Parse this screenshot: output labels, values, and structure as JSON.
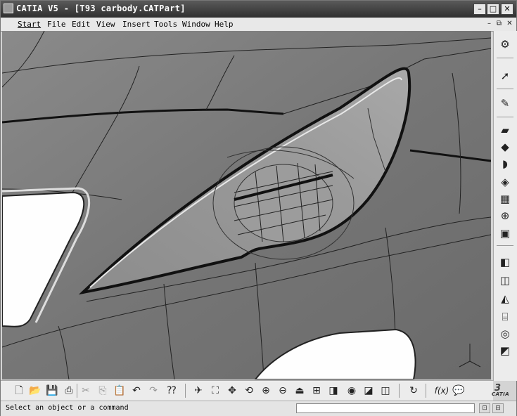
{
  "window": {
    "title": "CATIA V5 - [T93 carbody.CATPart]",
    "minimize_glyph": "–",
    "maximize_glyph": "□",
    "close_glyph": "✕"
  },
  "menu": {
    "items": [
      {
        "label": "Start",
        "active": true
      },
      {
        "label": "File"
      },
      {
        "label": "Edit"
      },
      {
        "label": "View"
      },
      {
        "label": "Insert"
      },
      {
        "label": "Tools"
      },
      {
        "label": "Window"
      },
      {
        "label": "Help"
      }
    ],
    "mdi_minimize": "–",
    "mdi_restore": "⧉",
    "mdi_close": "✕"
  },
  "right_toolbar": {
    "icons": [
      {
        "name": "sketcher-gear-icon",
        "glyph": "⚙"
      },
      {
        "name": "select-arrow-icon",
        "glyph": "➚"
      },
      {
        "name": "sketch-icon",
        "glyph": "✎"
      },
      {
        "name": "pad-icon",
        "glyph": "▰"
      },
      {
        "name": "pocket-icon",
        "glyph": "◆"
      },
      {
        "name": "shaft-icon",
        "glyph": "◗"
      },
      {
        "name": "hole-icon",
        "glyph": "◈"
      },
      {
        "name": "rib-icon",
        "glyph": "▦"
      },
      {
        "name": "axis-system-icon",
        "glyph": "⊕"
      },
      {
        "name": "box-icon",
        "glyph": "▣"
      },
      {
        "name": "plane-icon",
        "glyph": "◧"
      },
      {
        "name": "offset-icon",
        "glyph": "◫"
      },
      {
        "name": "shell-icon",
        "glyph": "◭"
      },
      {
        "name": "cylinder-icon",
        "glyph": "⌸"
      },
      {
        "name": "measure-icon",
        "glyph": "◎"
      },
      {
        "name": "apply-material-icon",
        "glyph": "◩"
      }
    ]
  },
  "bottom_toolbar": {
    "icons": [
      {
        "name": "new-icon",
        "glyph": "🗋"
      },
      {
        "name": "open-icon",
        "glyph": "📂"
      },
      {
        "name": "save-icon",
        "glyph": "💾"
      },
      {
        "name": "print-icon",
        "glyph": "⎙"
      },
      {
        "name": "cut-icon",
        "glyph": "✂"
      },
      {
        "name": "copy-icon",
        "glyph": "⎘"
      },
      {
        "name": "paste-icon",
        "glyph": "📋"
      },
      {
        "name": "undo-icon",
        "glyph": "↶"
      },
      {
        "name": "redo-icon",
        "glyph": "↷"
      },
      {
        "name": "whats-this-icon",
        "glyph": "⁇"
      },
      {
        "name": "fly-mode-icon",
        "glyph": "✈"
      },
      {
        "name": "fit-all-icon",
        "glyph": "⛶"
      },
      {
        "name": "pan-icon",
        "glyph": "✥"
      },
      {
        "name": "rotate-icon",
        "glyph": "⟲"
      },
      {
        "name": "zoom-in-icon",
        "glyph": "⊕"
      },
      {
        "name": "zoom-out-icon",
        "glyph": "⊖"
      },
      {
        "name": "normal-view-icon",
        "glyph": "⏏"
      },
      {
        "name": "multi-view-icon",
        "glyph": "⊞"
      },
      {
        "name": "iso-view-icon",
        "glyph": "◨"
      },
      {
        "name": "render-style-icon",
        "glyph": "◉"
      },
      {
        "name": "hide-show-icon",
        "glyph": "◪"
      },
      {
        "name": "swap-visible-icon",
        "glyph": "◫"
      },
      {
        "name": "update-icon",
        "glyph": "↻"
      },
      {
        "name": "formula-icon",
        "glyph": "f(x)"
      },
      {
        "name": "knowledge-icon",
        "glyph": "💬"
      }
    ]
  },
  "logo": {
    "three": "3",
    "word": "CATIA"
  },
  "status": {
    "message": "Select an object or a command",
    "command_value": "",
    "btn1": "⊡",
    "btn2": "⊟"
  },
  "colors": {
    "viewport_bg": "#7e7e7e",
    "edge_dark": "#1a1a1a",
    "highlight": "#ffffff"
  }
}
